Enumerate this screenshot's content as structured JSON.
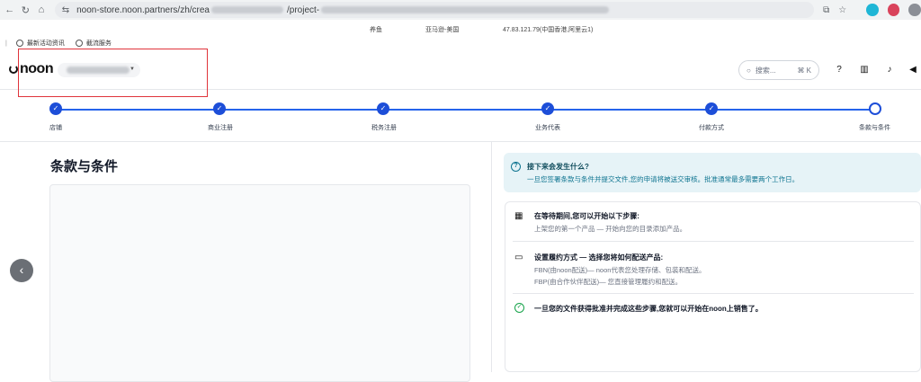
{
  "browser": {
    "url_prefix": "noon-store.noon.partners/zh/crea",
    "url_suffix": "/project-",
    "infobar": [
      "养鱼",
      "亚马逊-美国",
      "47.83.121.79(中国香港,阿里云1)"
    ],
    "bookmarks": [
      "最新活动资讯",
      "截流服务"
    ]
  },
  "header": {
    "logo": "noon",
    "search_placeholder": "搜索...",
    "search_shortcut": "⌘ K"
  },
  "stepper": {
    "steps": [
      "店铺",
      "商业注册",
      "税务注册",
      "业务代表",
      "付款方式",
      "条款与条件"
    ]
  },
  "main": {
    "title": "条款与条件"
  },
  "info": {
    "title": "接下来会发生什么?",
    "body": "一旦您签署条款与条件并提交文件,您的申请将被送交审核。批准通常最多需要两个工作日。"
  },
  "next_steps": {
    "row1_title": "在等待期间,您可以开始以下步骤:",
    "row1_desc": "上架您的第一个产品 — 开始向您的目录添加产品。",
    "row2_title": "设置履约方式 — 选择您将如何配送产品:",
    "row2_desc1": "FBN(由noon配送)— noon代表您处理存储、包装和配送。",
    "row2_desc2": "FBP(由合作伙伴配送)— 您直接管理履约和配送。",
    "row3_title": "一旦您的文件获得批准并完成这些步骤,您就可以开始在noon上销售了。"
  }
}
